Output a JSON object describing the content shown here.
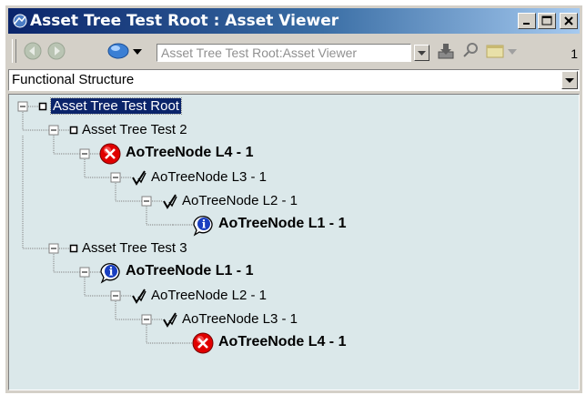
{
  "window": {
    "title": "Asset Tree Test Root : Asset Viewer",
    "caption_buttons": [
      "minimize",
      "maximize",
      "close"
    ]
  },
  "toolbar": {
    "address_text": "Asset Tree Test Root:Asset Viewer",
    "page_number": "1",
    "icons": [
      "back-arrow-icon",
      "forward-arrow-icon",
      "globe-icon",
      "dropdown-arrow-icon",
      "download-icon",
      "link-icon",
      "window-icon",
      "dropdown-arrow-icon"
    ]
  },
  "view_selector": {
    "value": "Functional Structure"
  },
  "tree": {
    "nodes": [
      {
        "label": "Asset Tree Test Root",
        "level": 0,
        "icon": "square-node-icon",
        "bold": false,
        "selected": true
      },
      {
        "label": "Asset Tree Test 2",
        "level": 1,
        "icon": "square-node-icon",
        "bold": false
      },
      {
        "label": "AoTreeNode L4 - 1",
        "level": 2,
        "icon": "error-icon",
        "bold": true
      },
      {
        "label": "AoTreeNode L3 - 1",
        "level": 3,
        "icon": "check-icon",
        "bold": false
      },
      {
        "label": "AoTreeNode L2 - 1",
        "level": 4,
        "icon": "check-icon",
        "bold": false
      },
      {
        "label": "AoTreeNode L1 - 1",
        "level": 5,
        "icon": "info-icon",
        "bold": true
      },
      {
        "label": "Asset Tree Test 3",
        "level": 1,
        "icon": "square-node-icon",
        "bold": false
      },
      {
        "label": "AoTreeNode L1 - 1",
        "level": 2,
        "icon": "info-icon",
        "bold": true
      },
      {
        "label": "AoTreeNode L2 - 1",
        "level": 3,
        "icon": "check-icon",
        "bold": false
      },
      {
        "label": "AoTreeNode L3 - 1",
        "level": 4,
        "icon": "check-icon",
        "bold": false
      },
      {
        "label": "AoTreeNode L4 - 1",
        "level": 5,
        "icon": "error-icon",
        "bold": true
      }
    ]
  },
  "colors": {
    "title_gradient_start": "#0a246a",
    "title_gradient_end": "#a6caf0",
    "tree_background": "#dbe8ea",
    "selection": "#0a246a",
    "error_red": "#e00000",
    "info_blue": "#1a3fc0"
  }
}
